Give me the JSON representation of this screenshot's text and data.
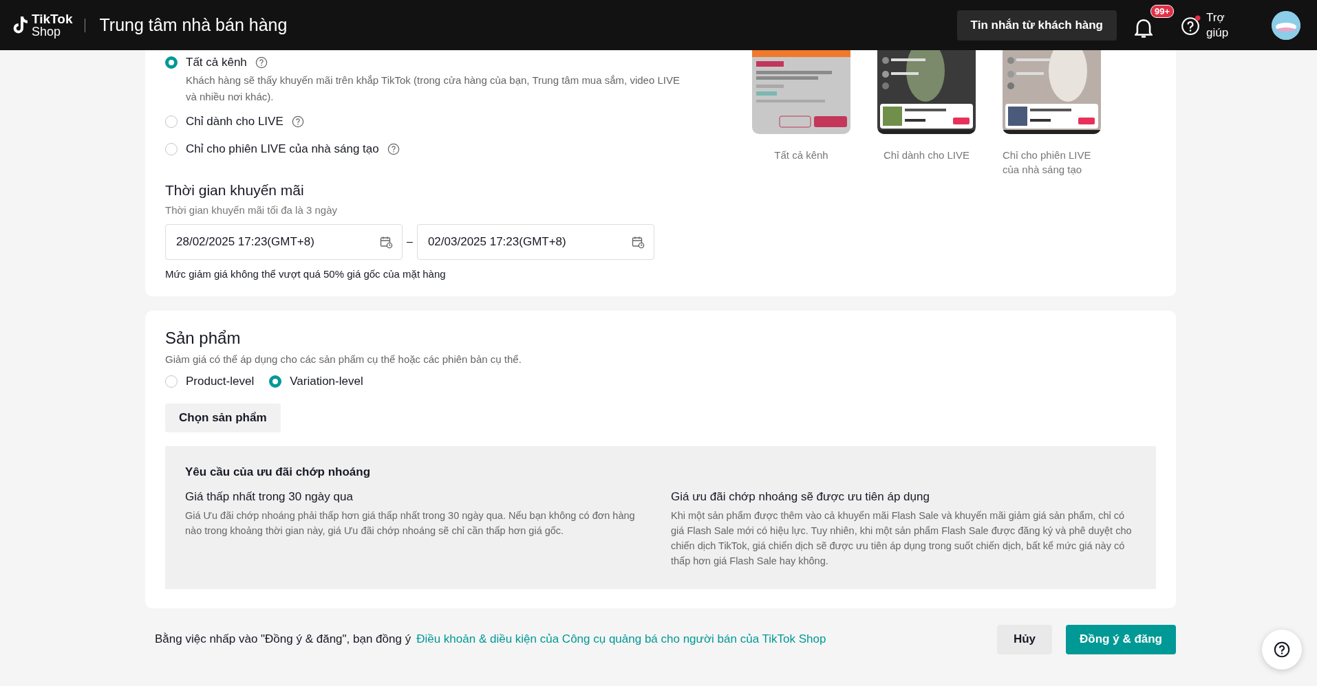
{
  "header": {
    "logo_top": "TikTok",
    "logo_bottom": "Shop",
    "title": "Trung tâm nhà bán hàng",
    "messages_button": "Tin nhắn từ khách hàng",
    "notification_badge": "99+",
    "help_label": "Trợ giúp"
  },
  "channels": {
    "options": [
      {
        "label": "Tất cả kênh",
        "selected": true,
        "description": "Khách hàng sẽ thấy khuyến mãi trên khắp TikTok (trong cửa hàng của bạn, Trung tâm mua sắm, video LIVE và nhiều nơi khác)."
      },
      {
        "label": "Chỉ dành cho LIVE",
        "selected": false
      },
      {
        "label": "Chỉ cho phiên LIVE của nhà sáng tạo",
        "selected": false
      }
    ],
    "previews": [
      {
        "caption": "Tất cả kênh"
      },
      {
        "caption": "Chỉ dành cho LIVE"
      },
      {
        "caption": "Chỉ cho phiên LIVE của nhà sáng tạo"
      }
    ]
  },
  "promo_time": {
    "title": "Thời gian khuyến mãi",
    "hint": "Thời gian khuyến mãi tối đa là 3 ngày",
    "start": "28/02/2025 17:23(GMT+8)",
    "separator": "–",
    "end": "02/03/2025 17:23(GMT+8)",
    "note": "Mức giảm giá không thể vượt quá 50% giá gốc của mặt hàng"
  },
  "products": {
    "title": "Sản phẩm",
    "subtitle": "Giảm giá có thể áp dụng cho các sản phẩm cụ thể hoặc các phiên bản cụ thể.",
    "levels": [
      {
        "label": "Product-level",
        "selected": false
      },
      {
        "label": "Variation-level",
        "selected": true
      }
    ],
    "choose_button": "Chọn sản phẩm",
    "requirements": {
      "title": "Yêu cầu của ưu đãi chớp nhoáng",
      "items": [
        {
          "heading": "Giá thấp nhất trong 30 ngày qua",
          "body": "Giá Ưu đãi chớp nhoáng phải thấp hơn giá thấp nhất trong 30 ngày qua. Nếu bạn không có đơn hàng nào trong khoảng thời gian này, giá Ưu đãi chớp nhoáng sẽ chỉ cần thấp hơn giá gốc."
        },
        {
          "heading": "Giá ưu đãi chớp nhoáng sẽ được ưu tiên áp dụng",
          "body": "Khi một sản phẩm được thêm vào cả khuyến mãi Flash Sale và khuyến mãi giảm giá sản phẩm, chỉ có giá Flash Sale mới có hiệu lực. Tuy nhiên, khi một sản phẩm Flash Sale được đăng ký và phê duyệt cho chiến dịch TikTok, giá chiến dịch sẽ được ưu tiên áp dụng trong suốt chiến dịch, bất kể mức giá này có thấp hơn giá Flash Sale hay không."
        }
      ]
    }
  },
  "footer": {
    "consent_text": "Bằng việc nhấp vào \"Đồng ý & đăng\", bạn đồng ý",
    "terms_link": "Điều khoản & diều kiện của Công cụ quảng bá cho người bán của TikTok Shop",
    "cancel_button": "Hủy",
    "confirm_button": "Đồng ý & đăng"
  }
}
